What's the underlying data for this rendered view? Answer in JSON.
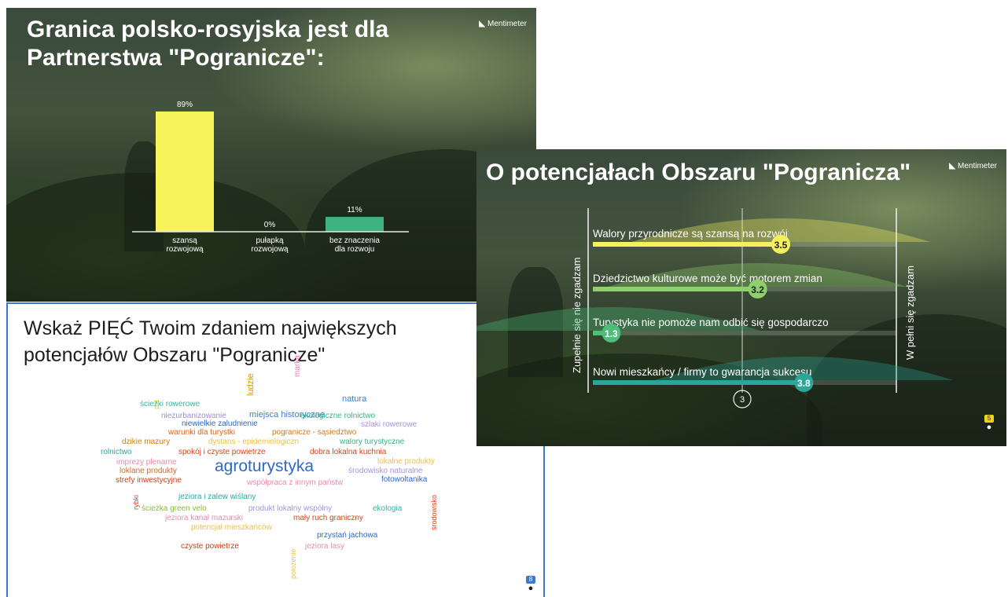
{
  "brand": "Mentimeter",
  "slide1": {
    "title": "Granica polsko-rosyjska jest dla Partnerstwa \"Pogranicze\":",
    "chart_data": {
      "type": "bar",
      "categories": [
        "szansą rozwojową",
        "pułapką rozwojową",
        "bez znaczenia dla rozwoju"
      ],
      "category_lines": [
        [
          "szansą",
          "rozwojową"
        ],
        [
          "pułapką",
          "rozwojową"
        ],
        [
          "bez znaczenia",
          "dla rozwoju"
        ]
      ],
      "values": [
        89,
        0,
        11
      ],
      "value_labels": [
        "89%",
        "0%",
        "11%"
      ],
      "colors": [
        "#f7f35b",
        "#f7f35b",
        "#3fb27f"
      ],
      "ylim": [
        0,
        100
      ]
    }
  },
  "slide2": {
    "title": "O potencjałach Obszaru \"Pogranicza\"",
    "chart_data": {
      "type": "scale",
      "left_label": "Zupełnie się nie zgadzam",
      "right_label": "W pełni się zgadzam",
      "xlim": [
        1,
        5
      ],
      "midpoint_label": "3",
      "items": [
        {
          "label": "Walory przyrodnicze są szansą na rozwój",
          "value": 3.5,
          "value_label": "3.5",
          "color": "#f4f05e"
        },
        {
          "label": "Dziedzictwo kulturowe może być motorem zmian",
          "value": 3.2,
          "value_label": "3.2",
          "color": "#8ed06a"
        },
        {
          "label": "Turystyka nie pomoże nam odbić się gospodarczo",
          "value": 1.3,
          "value_label": "1.3",
          "color": "#4dbd7a"
        },
        {
          "label": "Nowi mieszkańcy / firmy to gwarancja sukcesu",
          "value": 3.8,
          "value_label": "3.8",
          "color": "#2aa798"
        }
      ]
    },
    "participants": "5"
  },
  "slide3": {
    "title": "Wskaż PIĘĆ Twoim zdaniem największych potencjałów Obszaru \"Pogranicze\"",
    "participants": "8",
    "words": [
      {
        "t": "natura",
        "c": "#3b7fd6",
        "s": 11
      },
      {
        "t": "ludzie",
        "c": "#d9911c",
        "s": 11,
        "v": 1
      },
      {
        "t": "marka",
        "c": "#e17fb4",
        "s": 10,
        "v": 1
      },
      {
        "t": "ścieżki rowerowe",
        "c": "#3cb3a1",
        "s": 10
      },
      {
        "t": "miejsca historyczne",
        "c": "#3b7fd6",
        "s": 11
      },
      {
        "t": "pzł",
        "c": "#f0c040",
        "s": 9,
        "v": 1
      },
      {
        "t": "niezurbanizowanie",
        "c": "#9b8dd6",
        "s": 10
      },
      {
        "t": "ekologiczne rolnictwo",
        "c": "#35b38b",
        "s": 10
      },
      {
        "t": "niewielkie zaludnienie",
        "c": "#2f68c8",
        "s": 10
      },
      {
        "t": "szlaki rowerowe",
        "c": "#a493da",
        "s": 10
      },
      {
        "t": "warunki dla turystki",
        "c": "#d9641c",
        "s": 10
      },
      {
        "t": "pogranicze - sąsiedztwo",
        "c": "#cc7a2a",
        "s": 10
      },
      {
        "t": "dzikie mazury",
        "c": "#c8801d",
        "s": 10
      },
      {
        "t": "dystans - epidemiologiczn",
        "c": "#f0c040",
        "s": 10
      },
      {
        "t": "walory turystyczne",
        "c": "#35b38b",
        "s": 10
      },
      {
        "t": "rolnictwo",
        "c": "#2aa79e",
        "s": 10
      },
      {
        "t": "spokój i czyste powietrze",
        "c": "#d8431c",
        "s": 10
      },
      {
        "t": "dobra lokalna kuchnia",
        "c": "#d8431c",
        "s": 10
      },
      {
        "t": "lokalne produkty",
        "c": "#f0c040",
        "s": 10
      },
      {
        "t": "imprezy plenarne",
        "c": "#e58ab0",
        "s": 10
      },
      {
        "t": "agroturystyka",
        "c": "#2f68c8",
        "s": 21
      },
      {
        "t": "loklane produkty",
        "c": "#d9641c",
        "s": 10
      },
      {
        "t": "środowisko naturalne",
        "c": "#a493da",
        "s": 10
      },
      {
        "t": "strefy inwestycyjne",
        "c": "#c8401c",
        "s": 10
      },
      {
        "t": "współpraca z innym państw",
        "c": "#e58ab0",
        "s": 10
      },
      {
        "t": "fotowoltanika",
        "c": "#2f68c8",
        "s": 10
      },
      {
        "t": "rybki",
        "c": "#d8431c",
        "s": 9,
        "v": 1
      },
      {
        "t": "jeziora i zalew wiślany",
        "c": "#2aa79e",
        "s": 10
      },
      {
        "t": "środowisko",
        "c": "#d8431c",
        "s": 9,
        "v": 1
      },
      {
        "t": "ścieżka green velo",
        "c": "#8bb83a",
        "s": 10
      },
      {
        "t": "produkt lokalny wspólny",
        "c": "#a493da",
        "s": 10
      },
      {
        "t": "ekologia",
        "c": "#3cb3a1",
        "s": 10
      },
      {
        "t": "jeziora kanał mazurski",
        "c": "#e58ab0",
        "s": 10
      },
      {
        "t": "mały ruch graniczny",
        "c": "#d8431c",
        "s": 10
      },
      {
        "t": "potencjał mieszkańców",
        "c": "#f0c040",
        "s": 10
      },
      {
        "t": "przystań jachowa",
        "c": "#2f68c8",
        "s": 10
      },
      {
        "t": "czyste powietrze",
        "c": "#c8401c",
        "s": 10
      },
      {
        "t": "jeziora lasy",
        "c": "#e58ab0",
        "s": 10
      },
      {
        "t": "położenie",
        "c": "#f0c040",
        "s": 9,
        "v": 1
      }
    ]
  }
}
